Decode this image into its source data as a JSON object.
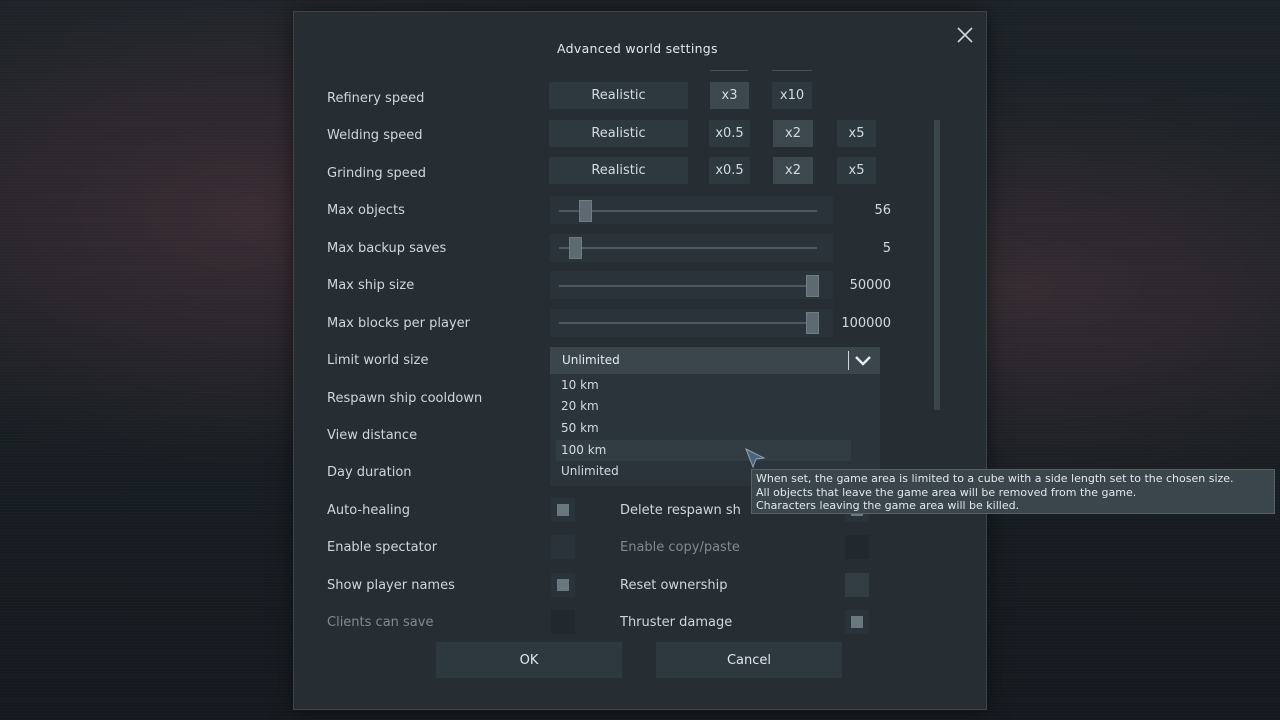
{
  "dialog": {
    "title": "Advanced world settings",
    "ok_label": "OK",
    "cancel_label": "Cancel"
  },
  "speed_rows": [
    {
      "label": "Refinery speed",
      "realistic": "Realistic",
      "options": [
        "x3",
        "x10"
      ],
      "selected": "x3"
    },
    {
      "label": "Welding speed",
      "realistic": "Realistic",
      "options": [
        "x0.5",
        "x2",
        "x5"
      ],
      "selected": "x2"
    },
    {
      "label": "Grinding speed",
      "realistic": "Realistic",
      "options": [
        "x0.5",
        "x2",
        "x5"
      ],
      "selected": "x2"
    }
  ],
  "sliders": [
    {
      "label": "Max objects",
      "value": "56",
      "fraction": 0.08
    },
    {
      "label": "Max backup saves",
      "value": "5",
      "fraction": 0.04
    },
    {
      "label": "Max ship size",
      "value": "50000",
      "fraction": 1.0
    },
    {
      "label": "Max blocks per player",
      "value": "100000",
      "fraction": 1.0
    }
  ],
  "limit_world_size": {
    "label": "Limit world size",
    "selected": "Unlimited",
    "options": [
      "10 km",
      "20 km",
      "50 km",
      "100 km",
      "Unlimited"
    ],
    "hovered": "100 km"
  },
  "other_labels": {
    "respawn_ship_cooldown": "Respawn ship cooldown",
    "view_distance": "View distance",
    "day_duration": "Day duration"
  },
  "checkboxes_left": [
    {
      "label": "Auto-healing",
      "checked": true,
      "enabled": true
    },
    {
      "label": "Enable spectator",
      "checked": false,
      "enabled": true
    },
    {
      "label": "Show player names",
      "checked": true,
      "enabled": true
    },
    {
      "label": "Clients can save",
      "checked": false,
      "enabled": false
    }
  ],
  "checkboxes_right": [
    {
      "label": "Delete respawn ships",
      "display": "Delete respawn sh",
      "checked": true,
      "enabled": true
    },
    {
      "label": "Enable copy/paste",
      "checked": false,
      "enabled": false
    },
    {
      "label": "Reset ownership",
      "checked": false,
      "enabled": true
    },
    {
      "label": "Thruster damage",
      "checked": true,
      "enabled": true
    }
  ],
  "tooltip": {
    "line1": "When set, the game area is limited to a cube with a side length set to the chosen size.",
    "line2": "All objects that leave the game area will be removed from the game.",
    "line3": "Characters leaving the game area will be killed."
  },
  "icons": {
    "close": "close-icon",
    "dropdown": "chevron-down-icon",
    "cursor": "mouse-cursor-icon"
  }
}
